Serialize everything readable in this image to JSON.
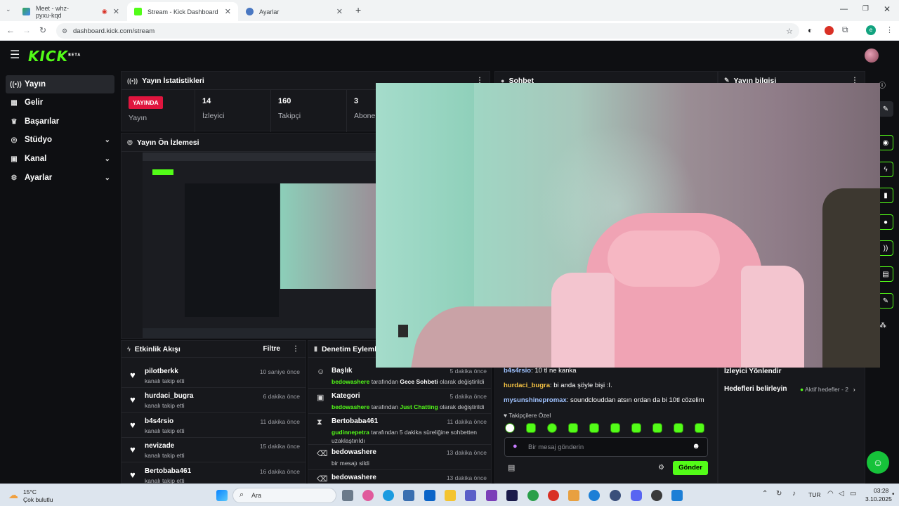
{
  "browser": {
    "tabs": [
      {
        "title": "Meet - whz-pyxu-kqd",
        "active": false
      },
      {
        "title": "Stream - Kick Dashboard",
        "active": true
      },
      {
        "title": "Ayarlar",
        "active": false
      }
    ],
    "url": "dashboard.kick.com/stream"
  },
  "brand": {
    "logo": "KICK",
    "beta": "BETA",
    "accent": "#53fc18"
  },
  "sidebar": {
    "items": [
      {
        "label": "Yayın",
        "icon": "broadcast-icon",
        "active": true
      },
      {
        "label": "Gelir",
        "icon": "revenue-icon"
      },
      {
        "label": "Başarılar",
        "icon": "trophy-icon"
      },
      {
        "label": "Stüdyo",
        "icon": "studio-icon",
        "expandable": true
      },
      {
        "label": "Kanal",
        "icon": "channel-icon",
        "expandable": true
      },
      {
        "label": "Ayarlar",
        "icon": "gear-icon",
        "expandable": true
      }
    ]
  },
  "stats": {
    "title": "Yayın İstatistikleri",
    "live_badge": "YAYINDA",
    "live_label": "Yayın",
    "viewers_value": "14",
    "viewers_label": "İzleyici",
    "followers_value": "160",
    "followers_label": "Takipçi",
    "subs_value": "3",
    "subs_label": "Abone"
  },
  "preview": {
    "title": "Yayın Ön İzlemesi"
  },
  "activity": {
    "title": "Etkinlik Akışı",
    "filter": "Filtre",
    "rows": [
      {
        "name": "pilotberkk",
        "sub": "kanalı takip etti",
        "time": "10 saniye önce"
      },
      {
        "name": "hurdaci_bugra",
        "sub": "kanalı takip etti",
        "time": "6 dakika önce"
      },
      {
        "name": "b4s4rsio",
        "sub": "kanalı takip etti",
        "time": "11 dakika önce"
      },
      {
        "name": "nevizade",
        "sub": "kanalı takip etti",
        "time": "15 dakika önce"
      },
      {
        "name": "Bertobaba461",
        "sub": "kanalı takip etti",
        "time": "16 dakika önce"
      }
    ]
  },
  "moderation": {
    "title": "Denetim Eylemleri",
    "rows": [
      {
        "name": "Başlık",
        "actor": "bedowashere",
        "mid": " tarafından ",
        "value": "Gece Sohbeti",
        "end": " olarak değiştirildi",
        "time": "5 dakika önce",
        "icon": "user-icon"
      },
      {
        "name": "Kategori",
        "actor": "bedowashere",
        "mid": " tarafından ",
        "value": "Just Chatting",
        "end": " olarak değiştirildi",
        "time": "5 dakika önce",
        "icon": "category-icon"
      },
      {
        "name": "Bertobaba461",
        "actor": "gudinnepetra",
        "mid": " tarafından 5 dakika süreliğine sohbetten uzaklaştırıldı",
        "value": "",
        "end": "",
        "time": "11 dakika önce",
        "icon": "hourglass-icon"
      },
      {
        "name": "bedowashere",
        "actor": "",
        "mid": "bir mesajı sildi",
        "value": "",
        "end": "",
        "time": "13 dakika önce",
        "icon": "trash-icon"
      },
      {
        "name": "bedowashere",
        "actor": "",
        "mid": "",
        "value": "",
        "end": "",
        "time": "13 dakika önce",
        "icon": "trash-icon"
      }
    ]
  },
  "chat": {
    "title": "Sohbet",
    "messages": [
      {
        "user": "b4s4rsio",
        "color": "#9fc2ff",
        "text": ": 10 tl ne kanka"
      },
      {
        "user": "hurdaci_bugra",
        "color": "#f6c343",
        "text": ": bi anda şöyle bişi :I."
      },
      {
        "user": "mysunshinepromax",
        "color": "#9fc2ff",
        "text": ": soundclouddan atsın ordan da bi 10tl cözelim"
      }
    ],
    "followers_only": "Takipçilere Özel",
    "input_placeholder": "Bir mesaj gönderin",
    "send": "Gönder"
  },
  "info": {
    "title": "Yayın bilgisi",
    "viewer_redirect": "İzleyici Yönlendir",
    "goals": "Hedefleri belirleyin",
    "active_goals": "Aktif hedefler - 2"
  },
  "taskbar": {
    "weather_temp": "15°C",
    "weather_desc": "Çok bulutlu",
    "search": "Ara",
    "lang": "TUR",
    "time": "03:28",
    "date": "3.10.2025"
  }
}
